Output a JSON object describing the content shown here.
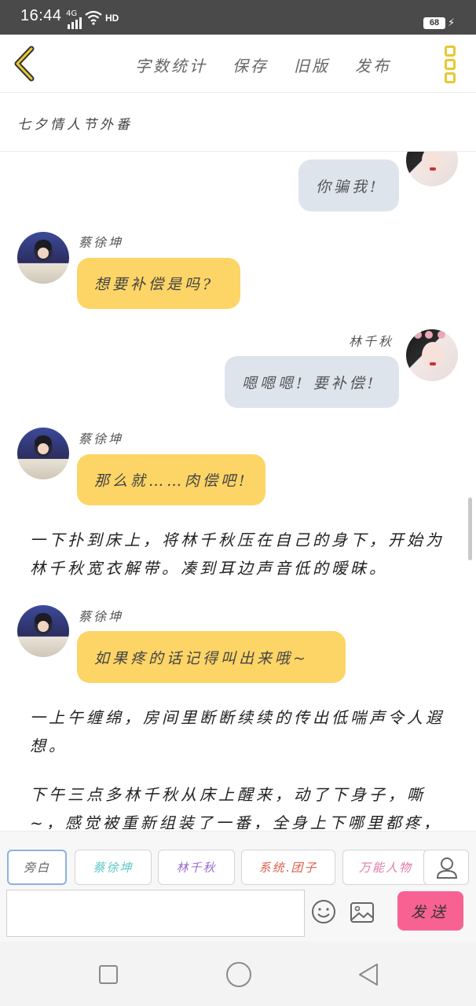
{
  "status_bar": {
    "time": "16:44",
    "network": "4G",
    "hd": "HD",
    "battery": "68"
  },
  "toolbar": {
    "actions": [
      "字数统计",
      "保存",
      "旧版",
      "发布"
    ]
  },
  "chapter": {
    "title": "七夕情人节外番"
  },
  "messages": [
    {
      "type": "bubble",
      "side": "right",
      "speaker": "",
      "text": "你骗我!"
    },
    {
      "type": "bubble",
      "side": "left",
      "speaker": "蔡徐坤",
      "text": "想要补偿是吗?"
    },
    {
      "type": "bubble",
      "side": "right",
      "speaker": "林千秋",
      "text": "嗯嗯嗯! 要补偿!"
    },
    {
      "type": "bubble",
      "side": "left",
      "speaker": "蔡徐坤",
      "text": "那么就……肉偿吧!"
    },
    {
      "type": "narration",
      "text": "一下扑到床上，将林千秋压在自己的身下，开始为林千秋宽衣解带。凑到耳边声音低的暧昧。"
    },
    {
      "type": "bubble",
      "side": "left",
      "speaker": "蔡徐坤",
      "text": "如果疼的话记得叫出来哦~"
    },
    {
      "type": "narration",
      "text": "一上午缠绵，房间里断断续续的传出低喘声令人遐想。"
    },
    {
      "type": "narration",
      "text": "下午三点多林千秋从床上醒来，动了下身子，嘶~，感觉被重新组装了一番，全身上下哪里都疼，"
    }
  ],
  "roles": [
    {
      "label": "旁白",
      "color": "#666666",
      "active": true
    },
    {
      "label": "蔡徐坤",
      "color": "#5cc8c8",
      "active": false
    },
    {
      "label": "林千秋",
      "color": "#9a6ad0",
      "active": false
    },
    {
      "label": "系统.团子",
      "color": "#e0604a",
      "active": false
    },
    {
      "label": "万能人物",
      "color": "#e07aa8",
      "active": false
    }
  ],
  "composer": {
    "value": "",
    "send_label": "发送"
  },
  "colors": {
    "accent_yellow": "#fdd566",
    "bubble_grey": "#dde4ec",
    "send_pink": "#f76293"
  }
}
